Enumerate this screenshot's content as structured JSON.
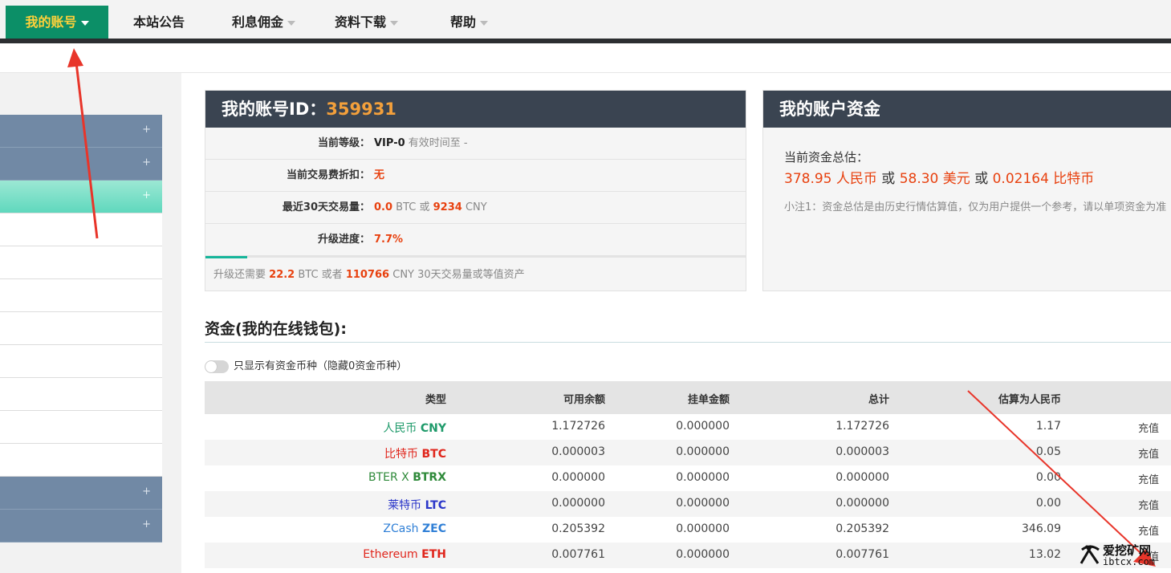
{
  "nav": {
    "items": [
      {
        "label": "我的账号",
        "has_caret": true,
        "active": true
      },
      {
        "label": "本站公告",
        "has_caret": false
      },
      {
        "label": "利息佣金",
        "has_caret": true
      },
      {
        "label": "资料下载",
        "has_caret": true
      },
      {
        "label": "帮助",
        "has_caret": true
      }
    ]
  },
  "sidebar": {
    "plus_glyph": "+"
  },
  "account": {
    "title": "我的账号ID：",
    "id": "359931",
    "level_label": "当前等级：",
    "level_value": "VIP-0",
    "level_expiry": "有效时间至 -",
    "discount_label": "当前交易费折扣：",
    "discount_value": "无",
    "volume_label": "最近30天交易量：",
    "volume_btc": "0.0",
    "volume_btc_unit": "BTC 或",
    "volume_cny": "9234",
    "volume_cny_unit": "CNY",
    "progress_label": "升级进度：",
    "progress_value": "7.7%",
    "progress_fraction": 0.077,
    "upgrade_prefix": "升级还需要",
    "upgrade_btc": "22.2",
    "upgrade_mid": "BTC 或者",
    "upgrade_cny": "110766",
    "upgrade_suffix": "CNY 30天交易量或等值资产"
  },
  "funds": {
    "title": "我的账户资金",
    "estimate_label": "当前资金总估：",
    "cny": "378.95 人民币",
    "or1": "或",
    "usd": "58.30 美元",
    "or2": "或",
    "btc": "0.02164 比特币",
    "note": "小注1：资金总估是由历史行情估算值，仅为用户提供一个参考，请以单项资金为准"
  },
  "wallet": {
    "title": "资金(我的在线钱包):",
    "toggle_label": "只显示有资金币种（隐藏0资金币种）",
    "headers": [
      "类型",
      "可用余额",
      "挂单金额",
      "总计",
      "估算为人民币"
    ],
    "action_label": "充值",
    "rows": [
      {
        "name": "人民币",
        "code": "CNY",
        "color": "#1e9a6a",
        "available": "1.172726",
        "frozen": "0.000000",
        "total": "1.172726",
        "cny": "1.17"
      },
      {
        "name": "比特币",
        "code": "BTC",
        "color": "#e0251b",
        "available": "0.000003",
        "frozen": "0.000000",
        "total": "0.000003",
        "cny": "0.05"
      },
      {
        "name": "BTER X",
        "code": "BTRX",
        "color": "#2f8a3a",
        "available": "0.000000",
        "frozen": "0.000000",
        "total": "0.000000",
        "cny": "0.00"
      },
      {
        "name": "莱特币",
        "code": "LTC",
        "color": "#2a36c9",
        "available": "0.000000",
        "frozen": "0.000000",
        "total": "0.000000",
        "cny": "0.00"
      },
      {
        "name": "ZCash",
        "code": "ZEC",
        "color": "#2f7fd6",
        "available": "0.205392",
        "frozen": "0.000000",
        "total": "0.205392",
        "cny": "346.09"
      },
      {
        "name": "Ethereum",
        "code": "ETH",
        "color": "#e0251b",
        "available": "0.007761",
        "frozen": "0.000000",
        "total": "0.007761",
        "cny": "13.02"
      }
    ]
  },
  "watermark": {
    "text": "爱挖矿网",
    "sub": "ibtcx.com"
  },
  "colors": {
    "nav_active_bg": "#0c8f67",
    "nav_active_text": "#ffd13a",
    "card_head_bg": "#3a4451",
    "accent_orange": "#e8410f",
    "annotation_red": "#e8352a"
  }
}
